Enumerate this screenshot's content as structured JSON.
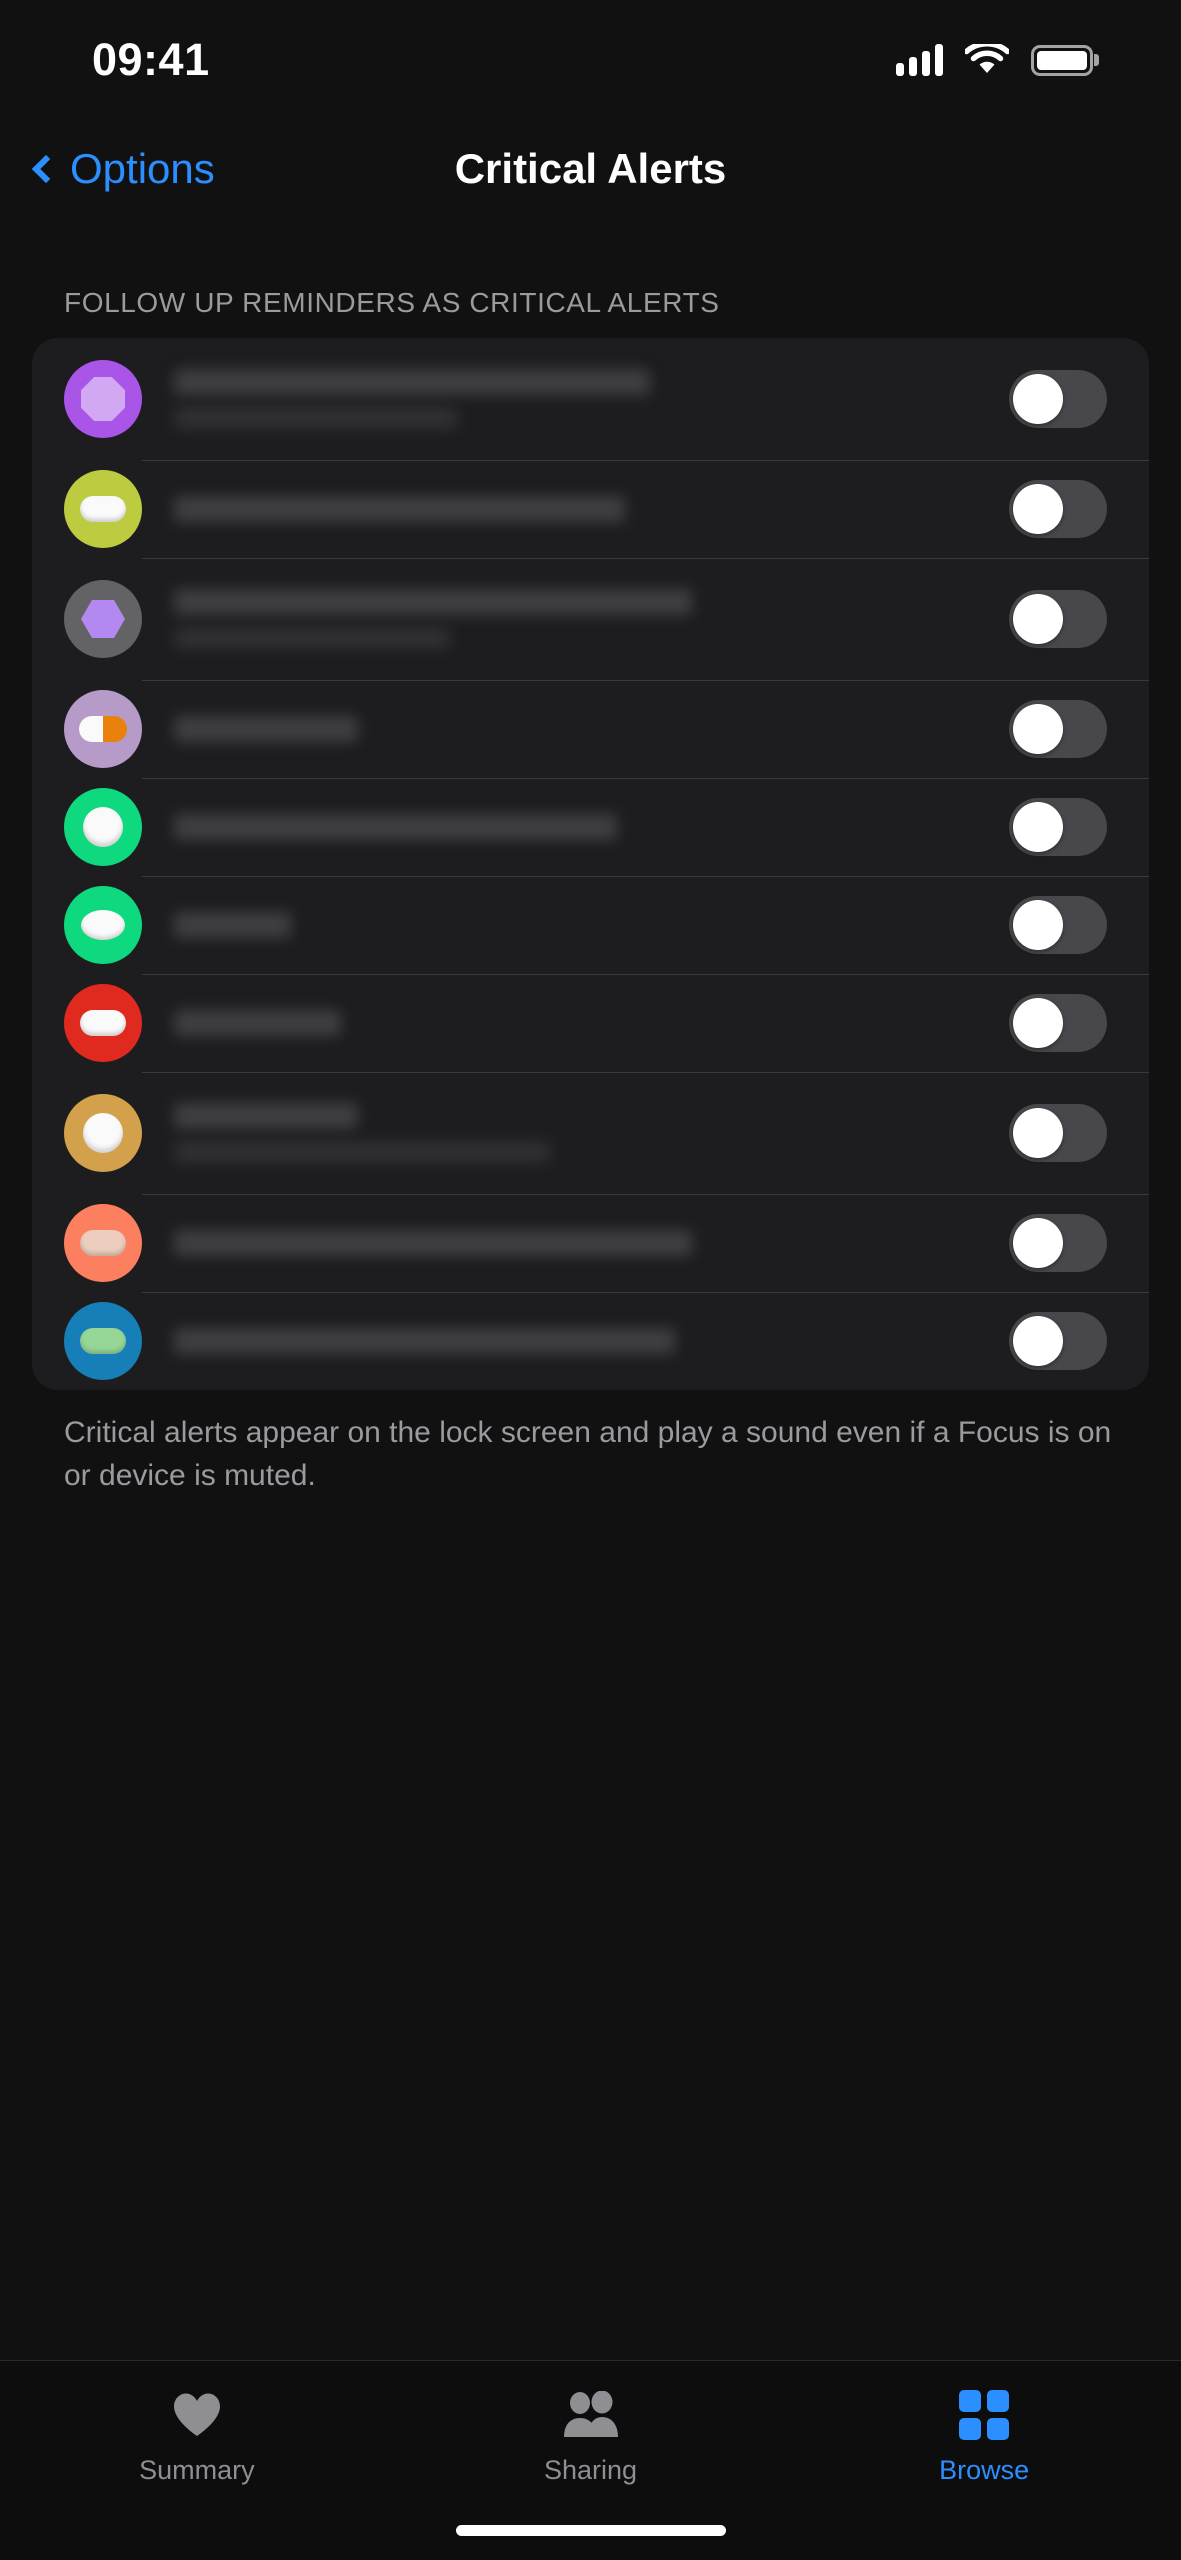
{
  "status_bar": {
    "time": "09:41",
    "cellular_icon": "cellular-bars-icon",
    "wifi_icon": "wifi-icon",
    "battery_icon": "battery-full-icon"
  },
  "nav": {
    "back_label": "Options",
    "back_icon": "chevron-left-icon",
    "title": "Critical Alerts"
  },
  "section": {
    "header": "FOLLOW UP REMINDERS AS CRITICAL ALERTS",
    "footer_note": "Critical alerts appear on the lock screen and play a sound even if a Focus is on or device is muted."
  },
  "colors": {
    "accent_blue": "#2b8fff",
    "screen_bg": "#111112",
    "card_bg": "#1d1d1f",
    "separator": "#3a3a3c",
    "secondary_text": "#9a9a9f",
    "toggle_off_track": "#48484c",
    "toggle_knob": "#ffffff"
  },
  "rows": [
    {
      "icon_name": "medication-icon-purple-octagon",
      "circle_color": "#a855e8",
      "pill_shape": "octagon",
      "pill_color": "#d3a8f2",
      "label_redacted": true,
      "label_line_widths": [
        "57%",
        "34%"
      ],
      "has_subtitle": true,
      "toggle_name": "critical-alert-toggle",
      "toggle_state": "off"
    },
    {
      "icon_name": "medication-icon-lime-capsule",
      "circle_color": "#bccb3f",
      "pill_shape": "capsule",
      "pill_color": "#fafafa",
      "label_redacted": true,
      "label_line_widths": [
        "54%"
      ],
      "has_subtitle": false,
      "toggle_name": "critical-alert-toggle",
      "toggle_state": "off"
    },
    {
      "icon_name": "medication-icon-gray-hexagon",
      "circle_color": "#636366",
      "pill_shape": "hexagon",
      "pill_color": "#b388f0",
      "label_redacted": true,
      "label_line_widths": [
        "62%",
        "33%"
      ],
      "has_subtitle": true,
      "toggle_name": "critical-alert-toggle",
      "toggle_state": "off"
    },
    {
      "icon_name": "medication-icon-lavender-capsule-orange",
      "circle_color": "#b69bc9",
      "pill_shape": "capsule-split",
      "pill_color": "#fafafa",
      "pill_color_2": "#e8820c",
      "label_redacted": true,
      "label_line_widths": [
        "22%"
      ],
      "has_subtitle": false,
      "toggle_name": "critical-alert-toggle",
      "toggle_state": "off"
    },
    {
      "icon_name": "medication-icon-green-tablet",
      "circle_color": "#0fd97f",
      "pill_shape": "tablet",
      "pill_color": "#fafafa",
      "label_redacted": true,
      "label_line_widths": [
        "53%"
      ],
      "has_subtitle": false,
      "toggle_name": "critical-alert-toggle",
      "toggle_state": "off"
    },
    {
      "icon_name": "medication-icon-green-oval",
      "circle_color": "#0fd97f",
      "pill_shape": "oval",
      "pill_color": "#fafafa",
      "label_redacted": true,
      "label_line_widths": [
        "14%"
      ],
      "has_subtitle": false,
      "toggle_name": "critical-alert-toggle",
      "toggle_state": "off"
    },
    {
      "icon_name": "medication-icon-red-capsule",
      "circle_color": "#e02a20",
      "pill_shape": "capsule",
      "pill_color": "#fafafa",
      "label_redacted": true,
      "label_line_widths": [
        "20%"
      ],
      "has_subtitle": false,
      "toggle_name": "critical-alert-toggle",
      "toggle_state": "off"
    },
    {
      "icon_name": "medication-icon-gold-tablet",
      "circle_color": "#d3a04b",
      "pill_shape": "tablet",
      "pill_color": "#fafafa",
      "label_redacted": true,
      "label_line_widths": [
        "22%",
        "45%"
      ],
      "has_subtitle": true,
      "toggle_name": "critical-alert-toggle",
      "toggle_state": "off"
    },
    {
      "icon_name": "medication-icon-coral-capsule",
      "circle_color": "#fc7f5f",
      "pill_shape": "capsule",
      "pill_color": "#edcdbe",
      "label_redacted": true,
      "label_line_widths": [
        "62%"
      ],
      "has_subtitle": false,
      "toggle_name": "critical-alert-toggle",
      "toggle_state": "off"
    },
    {
      "icon_name": "medication-icon-blue-capsule-green",
      "circle_color": "#167fb8",
      "pill_shape": "capsule",
      "pill_color": "#96d798",
      "label_redacted": true,
      "label_line_widths": [
        "60%"
      ],
      "has_subtitle": false,
      "toggle_name": "critical-alert-toggle",
      "toggle_state": "off"
    }
  ],
  "tab_bar": {
    "tabs": [
      {
        "label": "Summary",
        "icon": "heart-icon",
        "active": false
      },
      {
        "label": "Sharing",
        "icon": "people-icon",
        "active": false
      },
      {
        "label": "Browse",
        "icon": "grid-squares-icon",
        "active": true
      }
    ]
  }
}
